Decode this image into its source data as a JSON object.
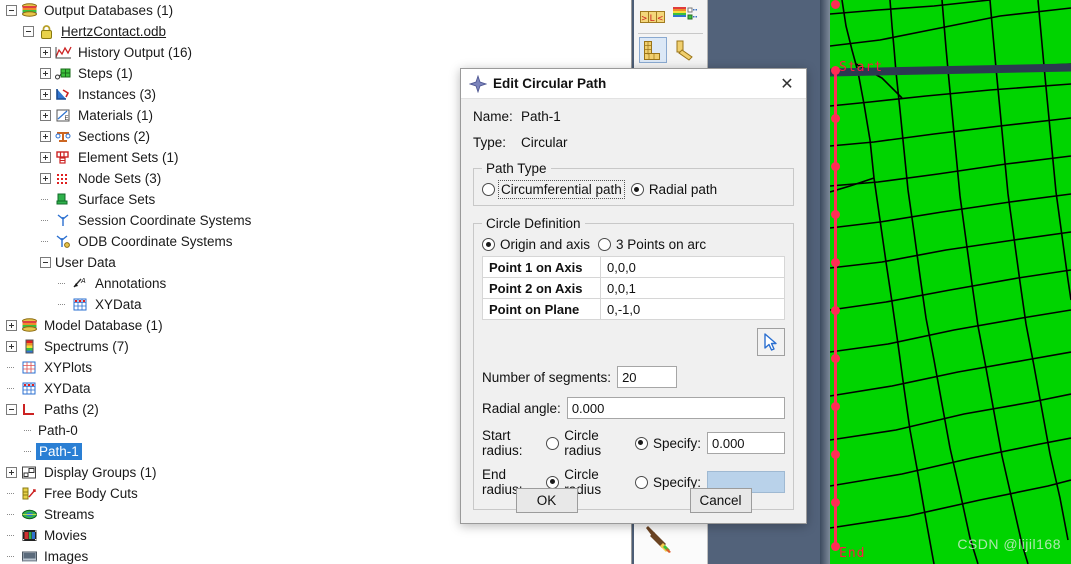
{
  "tree": {
    "items": [
      {
        "label": "Output Databases (1)",
        "indent": 0,
        "expander": "minus",
        "icon": "database-icon",
        "selected": false,
        "underline": false
      },
      {
        "label": "HertzContact.odb",
        "indent": 1,
        "expander": "minus",
        "icon": "lock-icon",
        "selected": false,
        "underline": true
      },
      {
        "label": "History Output (16)",
        "indent": 2,
        "expander": "plus",
        "icon": "history-output-icon",
        "selected": false,
        "underline": false
      },
      {
        "label": "Steps (1)",
        "indent": 2,
        "expander": "plus",
        "icon": "steps-icon",
        "selected": false,
        "underline": false
      },
      {
        "label": "Instances (3)",
        "indent": 2,
        "expander": "plus",
        "icon": "instances-icon",
        "selected": false,
        "underline": false
      },
      {
        "label": "Materials (1)",
        "indent": 2,
        "expander": "plus",
        "icon": "materials-icon",
        "selected": false,
        "underline": false
      },
      {
        "label": "Sections (2)",
        "indent": 2,
        "expander": "plus",
        "icon": "sections-icon",
        "selected": false,
        "underline": false
      },
      {
        "label": "Element Sets (1)",
        "indent": 2,
        "expander": "plus",
        "icon": "element-sets-icon",
        "selected": false,
        "underline": false
      },
      {
        "label": "Node Sets (3)",
        "indent": 2,
        "expander": "plus",
        "icon": "node-sets-icon",
        "selected": false,
        "underline": false
      },
      {
        "label": "Surface Sets",
        "indent": 2,
        "expander": "none",
        "icon": "surface-sets-icon",
        "selected": false,
        "underline": false
      },
      {
        "label": "Session Coordinate Systems",
        "indent": 2,
        "expander": "none",
        "icon": "session-coord-icon",
        "selected": false,
        "underline": false
      },
      {
        "label": "ODB Coordinate Systems",
        "indent": 2,
        "expander": "none",
        "icon": "odb-coord-icon",
        "selected": false,
        "underline": false
      },
      {
        "label": "User Data",
        "indent": 2,
        "expander": "minus",
        "icon": "none",
        "selected": false,
        "underline": false
      },
      {
        "label": "Annotations",
        "indent": 3,
        "expander": "none",
        "icon": "annotations-icon",
        "selected": false,
        "underline": false
      },
      {
        "label": "XYData",
        "indent": 3,
        "expander": "none",
        "icon": "xydata-icon",
        "selected": false,
        "underline": false
      },
      {
        "label": "Model Database (1)",
        "indent": 0,
        "expander": "plus",
        "icon": "database-icon",
        "selected": false,
        "underline": false
      },
      {
        "label": "Spectrums (7)",
        "indent": 0,
        "expander": "plus",
        "icon": "spectrum-icon",
        "selected": false,
        "underline": false
      },
      {
        "label": "XYPlots",
        "indent": 0,
        "expander": "none",
        "icon": "xyplots-icon",
        "selected": false,
        "underline": false
      },
      {
        "label": "XYData",
        "indent": 0,
        "expander": "none",
        "icon": "xydata-icon",
        "selected": false,
        "underline": false
      },
      {
        "label": "Paths (2)",
        "indent": 0,
        "expander": "minus",
        "icon": "paths-icon",
        "selected": false,
        "underline": false
      },
      {
        "label": "Path-0",
        "indent": 1,
        "expander": "none",
        "icon": "none",
        "selected": false,
        "underline": false
      },
      {
        "label": "Path-1",
        "indent": 1,
        "expander": "none",
        "icon": "none",
        "selected": true,
        "underline": false
      },
      {
        "label": "Display Groups (1)",
        "indent": 0,
        "expander": "plus",
        "icon": "display-groups-icon",
        "selected": false,
        "underline": false
      },
      {
        "label": "Free Body Cuts",
        "indent": 0,
        "expander": "none",
        "icon": "free-body-cuts-icon",
        "selected": false,
        "underline": false
      },
      {
        "label": "Streams",
        "indent": 0,
        "expander": "none",
        "icon": "streams-icon",
        "selected": false,
        "underline": false
      },
      {
        "label": "Movies",
        "indent": 0,
        "expander": "none",
        "icon": "movies-icon",
        "selected": false,
        "underline": false
      },
      {
        "label": "Images",
        "indent": 0,
        "expander": "none",
        "icon": "images-icon",
        "selected": false,
        "underline": false
      }
    ]
  },
  "toolbar": {
    "buttons": [
      {
        "name": "path-ends-icon"
      },
      {
        "name": "spectrum-list-icon"
      },
      {
        "name": "create-path-icon"
      },
      {
        "name": "edit-path-icon"
      }
    ]
  },
  "dialog": {
    "title": "Edit Circular Path",
    "title_icon": "compass-diamond-icon",
    "close_label": "✕",
    "name_label": "Name:",
    "name_value": "Path-1",
    "type_label": "Type:",
    "type_value": "Circular",
    "path_type": {
      "legend": "Path Type",
      "options": [
        {
          "label": "Circumferential path",
          "selected": false,
          "focused": true
        },
        {
          "label": "Radial path",
          "selected": true,
          "focused": false
        }
      ]
    },
    "circle_definition": {
      "legend": "Circle Definition",
      "options": [
        {
          "label": "Origin and axis",
          "selected": true
        },
        {
          "label": "3 Points on arc",
          "selected": false
        }
      ],
      "table": [
        {
          "key": "Point 1 on Axis",
          "value": "0,0,0"
        },
        {
          "key": "Point 2 on Axis",
          "value": "0,0,1"
        },
        {
          "key": "Point on Plane",
          "value": "0,-1,0"
        }
      ],
      "pick_button_icon": "cursor-arrow-icon",
      "segments_label": "Number of segments:",
      "segments_value": "20",
      "radial_angle_label": "Radial angle:",
      "radial_angle_value": "0.000",
      "start_radius_label": "Start radius:",
      "start_radius_circle_label": "Circle radius",
      "start_radius_circle_selected": false,
      "start_radius_specify_label": "Specify:",
      "start_radius_specify_selected": true,
      "start_radius_value": "0.000",
      "end_radius_label": "End radius:",
      "end_radius_circle_label": "Circle radius",
      "end_radius_circle_selected": true,
      "end_radius_specify_label": "Specify:",
      "end_radius_specify_selected": false,
      "end_radius_value": ""
    },
    "ok_label": "OK",
    "cancel_label": "Cancel"
  },
  "viewport": {
    "start_label": "Start",
    "end_label": "End",
    "watermark": "CSDN @lijil168",
    "mesh_color": "#00d400",
    "path_color": "#ff2d55",
    "background_color": "#52627a"
  }
}
